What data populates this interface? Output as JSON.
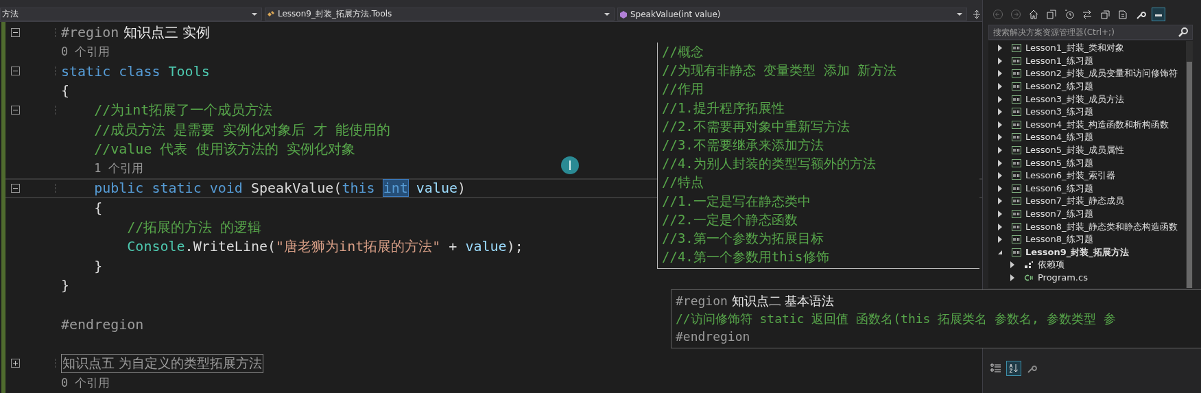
{
  "nav_bar": {
    "dropdowns": [
      {
        "label": "方法",
        "kind": "plain"
      },
      {
        "label": "Lesson9_封装_拓展方法.Tools",
        "kind": "class"
      },
      {
        "label": "SpeakValue(int value)",
        "kind": "method"
      }
    ]
  },
  "editor": {
    "lines": [
      {
        "kind": "code",
        "expanded": true,
        "tokens": [
          {
            "t": "#region",
            "kind": "directive"
          },
          {
            "t": " 知识点三 实例",
            "kind": "region"
          }
        ]
      },
      {
        "kind": "codelens",
        "text": "0 个引用"
      },
      {
        "kind": "code",
        "expanded": true,
        "tokens": [
          {
            "t": "static class",
            "kind": "keyword"
          },
          {
            "t": " Tools",
            "kind": "type"
          }
        ]
      },
      {
        "kind": "code",
        "tokens": [
          {
            "t": "{",
            "kind": "plain"
          }
        ]
      },
      {
        "kind": "code",
        "expanded": true,
        "tokens": [
          {
            "t": "    //为int拓展了一个成员方法",
            "kind": "comment"
          }
        ]
      },
      {
        "kind": "code",
        "tokens": [
          {
            "t": "    //成员方法 是需要 实例化对象后 才 能使用的",
            "kind": "comment"
          }
        ]
      },
      {
        "kind": "code",
        "tokens": [
          {
            "t": "    //value 代表 使用该方法的 实例化对象",
            "kind": "comment"
          }
        ]
      },
      {
        "kind": "codelens",
        "text": "    1 个引用"
      },
      {
        "kind": "code",
        "expanded": true,
        "current": true,
        "tokens": [
          {
            "t": "    public static void",
            "kind": "keyword"
          },
          {
            "t": " SpeakValue",
            "kind": "method"
          },
          {
            "t": "(",
            "kind": "plain"
          },
          {
            "t": "this ",
            "kind": "keyword"
          },
          {
            "t": "int",
            "kind": "selected"
          },
          {
            "t": " value",
            "kind": "param"
          },
          {
            "t": ")",
            "kind": "plain"
          }
        ]
      },
      {
        "kind": "code",
        "tokens": [
          {
            "t": "    {",
            "kind": "plain"
          }
        ]
      },
      {
        "kind": "code",
        "tokens": [
          {
            "t": "        //拓展的方法 的逻辑",
            "kind": "comment"
          }
        ]
      },
      {
        "kind": "code",
        "tokens": [
          {
            "t": "        Console",
            "kind": "type"
          },
          {
            "t": ".",
            "kind": "plain"
          },
          {
            "t": "WriteLine",
            "kind": "method"
          },
          {
            "t": "(",
            "kind": "plain"
          },
          {
            "t": "\"唐老狮为int拓展的方法\"",
            "kind": "string"
          },
          {
            "t": " + ",
            "kind": "plain"
          },
          {
            "t": "value",
            "kind": "param"
          },
          {
            "t": ");",
            "kind": "plain"
          }
        ]
      },
      {
        "kind": "code",
        "tokens": [
          {
            "t": "    }",
            "kind": "plain"
          }
        ]
      },
      {
        "kind": "code",
        "tokens": [
          {
            "t": "}",
            "kind": "plain"
          }
        ]
      },
      {
        "kind": "blank"
      },
      {
        "kind": "code",
        "tokens": [
          {
            "t": "#endregion",
            "kind": "directive"
          }
        ]
      },
      {
        "kind": "blank"
      },
      {
        "kind": "collapsed",
        "expanded": false,
        "text": "知识点五 为自定义的类型拓展方法"
      },
      {
        "kind": "codelens",
        "text": "0 个引用"
      }
    ]
  },
  "peek_popups": [
    {
      "kind": "notes",
      "lines": [
        {
          "tokens": [
            {
              "t": "//概念",
              "kind": "comment"
            }
          ]
        },
        {
          "tokens": [
            {
              "t": "//为现有非静态 变量类型 添加 新方法",
              "kind": "comment"
            }
          ]
        },
        {
          "tokens": [
            {
              "t": "//作用",
              "kind": "comment"
            }
          ]
        },
        {
          "tokens": [
            {
              "t": "//1.提升程序拓展性",
              "kind": "comment"
            }
          ]
        },
        {
          "tokens": [
            {
              "t": "//2.不需要再对象中重新写方法",
              "kind": "comment"
            }
          ]
        },
        {
          "tokens": [
            {
              "t": "//3.不需要继承来添加方法",
              "kind": "comment"
            }
          ]
        },
        {
          "tokens": [
            {
              "t": "//4.为别人封装的类型写额外的方法",
              "kind": "comment"
            }
          ]
        },
        {
          "tokens": [
            {
              "t": "//特点",
              "kind": "comment"
            }
          ]
        },
        {
          "tokens": [
            {
              "t": "//1.一定是写在静态类中",
              "kind": "comment"
            }
          ]
        },
        {
          "tokens": [
            {
              "t": "//2.一定是个静态函数",
              "kind": "comment"
            }
          ]
        },
        {
          "tokens": [
            {
              "t": "//3.第一个参数为拓展目标",
              "kind": "comment"
            }
          ]
        },
        {
          "tokens": [
            {
              "t": "//4.第一个参数用this修饰",
              "kind": "comment"
            }
          ]
        }
      ]
    },
    {
      "kind": "region",
      "lines": [
        {
          "tokens": [
            {
              "t": "#region",
              "kind": "directive"
            },
            {
              "t": " 知识点二 基本语法",
              "kind": "region"
            }
          ]
        },
        {
          "tokens": [
            {
              "t": "//访问修饰符 static 返回值 函数名(this 拓展类名 参数名, 参数类型 参",
              "kind": "comment"
            }
          ]
        },
        {
          "tokens": [
            {
              "t": "#endregion",
              "kind": "directive"
            }
          ]
        }
      ]
    }
  ],
  "solution_explorer": {
    "toolbar": [
      {
        "kind": "back",
        "disabled": true,
        "selected": false
      },
      {
        "kind": "forward",
        "disabled": true,
        "selected": false
      },
      {
        "kind": "home",
        "disabled": false,
        "selected": false
      },
      {
        "kind": "switch-views",
        "disabled": false,
        "selected": false
      },
      {
        "kind": "pending",
        "disabled": false,
        "selected": false
      },
      {
        "kind": "sync",
        "disabled": false,
        "selected": false
      },
      {
        "kind": "collapse",
        "disabled": false,
        "selected": false
      },
      {
        "kind": "show-all",
        "disabled": false,
        "selected": false
      },
      {
        "kind": "properties",
        "disabled": false,
        "selected": false
      },
      {
        "kind": "preview",
        "disabled": false,
        "selected": true
      }
    ],
    "search": {
      "placeholder": "搜索解决方案资源管理器(Ctrl+;)"
    },
    "items": [
      {
        "label": "Lesson1_封装_类和对象",
        "kind": "project",
        "expanded": false,
        "startup": false
      },
      {
        "label": "Lesson1_练习题",
        "kind": "project",
        "expanded": false,
        "startup": false
      },
      {
        "label": "Lesson2_封装_成员变量和访问修饰符",
        "kind": "project",
        "expanded": false,
        "startup": false
      },
      {
        "label": "Lesson2_练习题",
        "kind": "project",
        "expanded": false,
        "startup": false
      },
      {
        "label": "Lesson3_封装_成员方法",
        "kind": "project",
        "expanded": false,
        "startup": false
      },
      {
        "label": "Lesson3_练习题",
        "kind": "project",
        "expanded": false,
        "startup": false
      },
      {
        "label": "Lesson4_封装_构造函数和析构函数",
        "kind": "project",
        "expanded": false,
        "startup": false
      },
      {
        "label": "Lesson4_练习题",
        "kind": "project",
        "expanded": false,
        "startup": false
      },
      {
        "label": "Lesson5_封装_成员属性",
        "kind": "project",
        "expanded": false,
        "startup": false
      },
      {
        "label": "Lesson5_练习题",
        "kind": "project",
        "expanded": false,
        "startup": false
      },
      {
        "label": "Lesson6_封装_索引器",
        "kind": "project",
        "expanded": false,
        "startup": false
      },
      {
        "label": "Lesson6_练习题",
        "kind": "project",
        "expanded": false,
        "startup": false
      },
      {
        "label": "Lesson7_封装_静态成员",
        "kind": "project",
        "expanded": false,
        "startup": false
      },
      {
        "label": "Lesson7_练习题",
        "kind": "project",
        "expanded": false,
        "startup": false
      },
      {
        "label": "Lesson8_封装_静态类和静态构造函数",
        "kind": "project",
        "expanded": false,
        "startup": false
      },
      {
        "label": "Lesson8_练习题",
        "kind": "project",
        "expanded": false,
        "startup": false
      },
      {
        "label": "Lesson9_封装_拓展方法",
        "kind": "project",
        "expanded": true,
        "startup": true,
        "children": [
          {
            "label": "依赖项",
            "kind": "dependencies",
            "expanded": false
          },
          {
            "label": "Program.cs",
            "kind": "csfile",
            "expanded": false
          }
        ]
      }
    ]
  },
  "properties_toolbar": [
    {
      "kind": "categorized",
      "selected": false
    },
    {
      "kind": "alphabetical",
      "selected": true
    },
    {
      "kind": "pages",
      "selected": false
    }
  ]
}
